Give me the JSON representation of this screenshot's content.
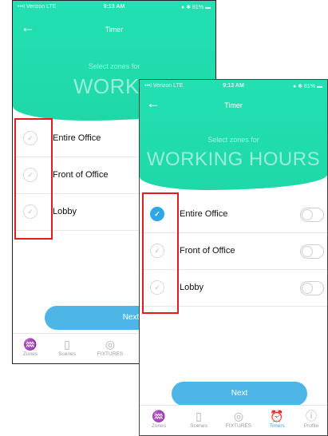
{
  "status_bar": {
    "carrier": "•••l Verizon  LTE",
    "time": "9:13 AM",
    "battery": "● ✱ 81% ▬"
  },
  "header": {
    "back_glyph": "←",
    "title": "Timer"
  },
  "hero": {
    "subtitle": "Select zones for",
    "heading": "WORKING HOURS"
  },
  "back_screen": {
    "heading_partial": "WORKING H"
  },
  "zones": [
    {
      "label": "Entire Office",
      "selected_after": true
    },
    {
      "label": "Front of Office",
      "selected_after": false
    },
    {
      "label": "Lobby",
      "selected_after": false
    }
  ],
  "check_glyph": "✓",
  "next_label": "Next",
  "tabs": [
    {
      "label": "Zones",
      "icon": "tree-icon",
      "glyph": "♒"
    },
    {
      "label": "Scenes",
      "icon": "door-icon",
      "glyph": "▯"
    },
    {
      "label": "FIXTURES",
      "icon": "bulb-icon",
      "glyph": "◎"
    },
    {
      "label": "Timers",
      "icon": "alarm-clock-icon",
      "glyph": "⏰"
    },
    {
      "label": "Profile",
      "icon": "profile-icon",
      "glyph": "ⓘ"
    }
  ],
  "colors": {
    "accent_green": "#22e0b3",
    "accent_blue": "#2fa6e8",
    "next_button": "#4db6e6",
    "highlight_red": "#e01e1e"
  }
}
